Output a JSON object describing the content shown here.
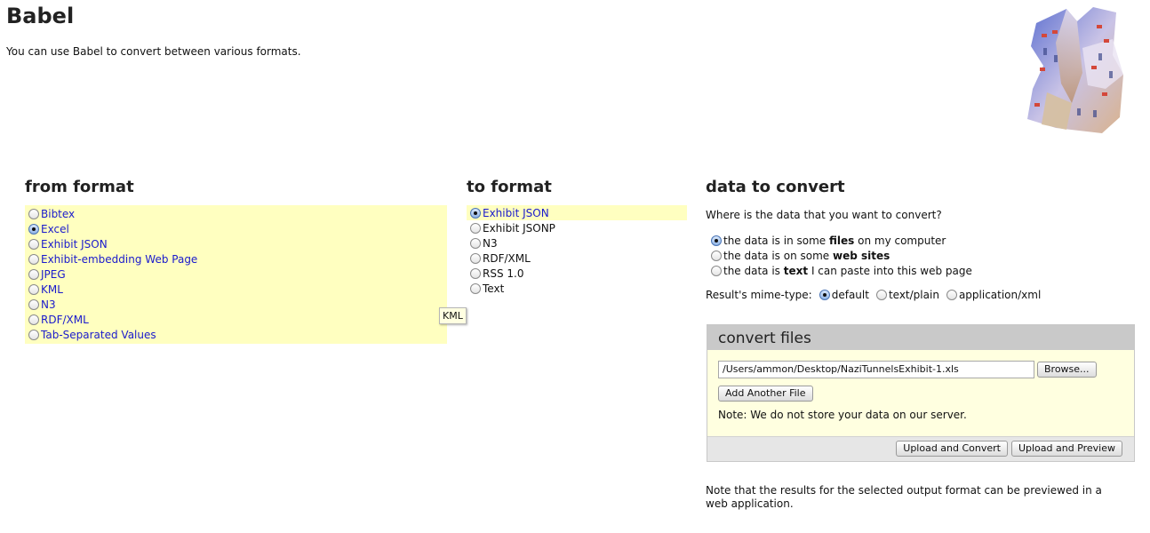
{
  "page": {
    "title": "Babel",
    "intro": "You can use Babel to convert between various formats."
  },
  "from_format": {
    "heading": "from format",
    "options": [
      {
        "label": "Bibtex",
        "selected": false
      },
      {
        "label": "Excel",
        "selected": true
      },
      {
        "label": "Exhibit JSON",
        "selected": false
      },
      {
        "label": "Exhibit-embedding Web Page",
        "selected": false
      },
      {
        "label": "JPEG",
        "selected": false
      },
      {
        "label": "KML",
        "selected": false
      },
      {
        "label": "N3",
        "selected": false
      },
      {
        "label": "RDF/XML",
        "selected": false
      },
      {
        "label": "Tab-Separated Values",
        "selected": false
      }
    ]
  },
  "tooltip": "KML",
  "to_format": {
    "heading": "to format",
    "options": [
      {
        "label": "Exhibit JSON",
        "selected": true
      },
      {
        "label": "Exhibit JSONP",
        "selected": false
      },
      {
        "label": "N3",
        "selected": false
      },
      {
        "label": "RDF/XML",
        "selected": false
      },
      {
        "label": "RSS 1.0",
        "selected": false
      },
      {
        "label": "Text",
        "selected": false
      }
    ]
  },
  "data_to_convert": {
    "heading": "data to convert",
    "question": "Where is the data that you want to convert?",
    "sources": [
      {
        "pre": "the data is in some ",
        "bold": "files",
        "post": " on my computer",
        "selected": true
      },
      {
        "pre": "the data is on some ",
        "bold": "web sites",
        "post": "",
        "selected": false
      },
      {
        "pre": "the data is ",
        "bold": "text",
        "post": " I can paste into this web page",
        "selected": false
      }
    ],
    "mime_label": "Result's mime-type:",
    "mime_options": [
      {
        "label": "default",
        "selected": true
      },
      {
        "label": "text/plain",
        "selected": false
      },
      {
        "label": "application/xml",
        "selected": false
      }
    ]
  },
  "convert_files": {
    "title": "convert files",
    "file_path": "/Users/ammon/Desktop/NaziTunnelsExhibit-1.xls",
    "browse_label": "Browse...",
    "add_file_label": "Add Another File",
    "storage_note": "Note: We do not store your data on our server.",
    "upload_convert_label": "Upload and Convert",
    "upload_preview_label": "Upload and Preview"
  },
  "preview_note": "Note that the results for the selected output format can be previewed in a web application."
}
